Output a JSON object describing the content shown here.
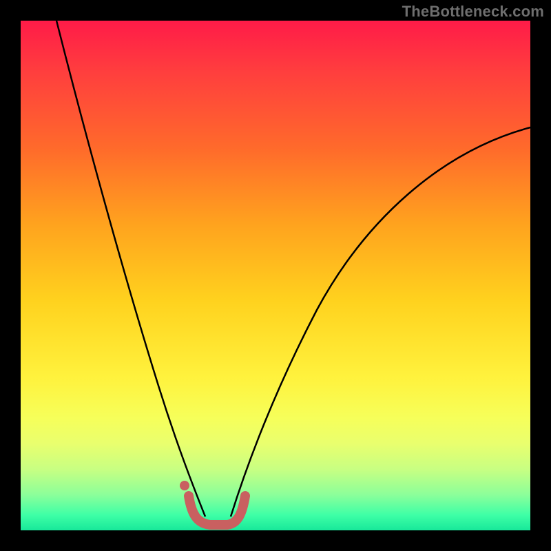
{
  "watermark": "TheBottleneck.com",
  "colors": {
    "frame": "#000000",
    "gradient_top": "#ff1b48",
    "gradient_bottom": "#18e89a",
    "curve": "#000000",
    "marker": "#c96060"
  },
  "chart_data": {
    "type": "line",
    "title": "",
    "xlabel": "",
    "ylabel": "",
    "xlim": [
      0,
      100
    ],
    "ylim": [
      0,
      100
    ],
    "series": [
      {
        "name": "left-branch",
        "x": [
          7,
          10,
          13,
          16,
          19,
          22,
          25,
          27,
          29,
          31,
          33,
          34,
          35,
          36
        ],
        "y": [
          100,
          83,
          68,
          54,
          42,
          32,
          23,
          17,
          12,
          8,
          5,
          3.5,
          2.5,
          2
        ]
      },
      {
        "name": "right-branch",
        "x": [
          41,
          42,
          44,
          46,
          49,
          53,
          58,
          65,
          73,
          82,
          91,
          100
        ],
        "y": [
          2,
          2.5,
          4,
          7,
          12,
          20,
          30,
          42,
          54,
          64,
          72,
          79
        ]
      },
      {
        "name": "bottom-marker",
        "x": [
          33,
          34,
          35,
          36,
          37,
          38,
          39,
          40,
          41,
          42,
          43
        ],
        "y": [
          6,
          3,
          1.5,
          1,
          1,
          1,
          1,
          1.2,
          1.8,
          3,
          6
        ]
      }
    ],
    "annotations": [
      {
        "name": "dot",
        "x": 32.2,
        "y": 8.8
      }
    ]
  }
}
